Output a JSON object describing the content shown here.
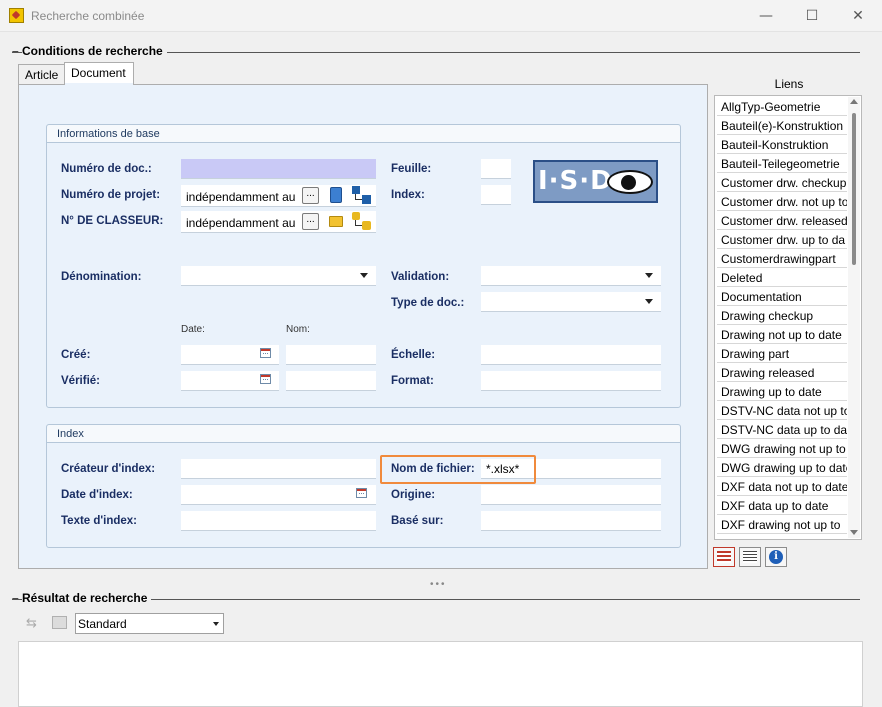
{
  "window": {
    "title": "Recherche combinée",
    "minimize": "—",
    "maximize": "☐",
    "close": "✕"
  },
  "search_conditions": {
    "heading": "Conditions de recherche",
    "collapse_glyph": "–",
    "tabs": [
      {
        "label": "Article",
        "active": false
      },
      {
        "label": "Document",
        "active": true
      }
    ]
  },
  "base_info": {
    "header": "Informations de base",
    "doc_number_label": "Numéro de doc.:",
    "doc_number_value": "",
    "project_number_label": "Numéro de projet:",
    "project_number_value": "indépendamment au",
    "binder_label": "N° DE CLASSEUR:",
    "binder_value": "indépendamment au",
    "dots_button": "...",
    "sheet_label": "Feuille:",
    "index_label": "Index:",
    "logo_text": "I·S·D",
    "designation_label": "Dénomination:",
    "validation_label": "Validation:",
    "doc_type_label": "Type de doc.:",
    "date_col_label": "Date:",
    "name_col_label": "Nom:",
    "created_label": "Créé:",
    "verified_label": "Vérifié:",
    "scale_label": "Échelle:",
    "format_label": "Format:"
  },
  "index_section": {
    "header": "Index",
    "index_creator_label": "Créateur d'index:",
    "index_date_label": "Date d'index:",
    "index_text_label": "Texte d'index:",
    "filename_label": "Nom de fichier:",
    "filename_value": "*.xlsx*",
    "origin_label": "Origine:",
    "based_on_label": "Basé sur:"
  },
  "liens": {
    "title": "Liens",
    "items": [
      "AllgTyp-Geometrie",
      "Bauteil(e)-Konstruktion",
      "Bauteil-Konstruktion",
      "Bauteil-Teilegeometrie",
      "Customer drw. checkup",
      "Customer drw. not up to",
      "Customer drw. released",
      "Customer drw. up to da",
      "Customerdrawingpart",
      "Deleted",
      "Documentation",
      "Drawing checkup",
      "Drawing not up to date",
      "Drawing part",
      "Drawing released",
      "Drawing up to date",
      "DSTV-NC data not up to",
      "DSTV-NC data up to dat",
      "DWG drawing not up to",
      "DWG drawing up to date",
      "DXF data not up to date",
      "DXF data up to date",
      "DXF drawing not up to"
    ]
  },
  "results": {
    "heading": "Résultat de recherche",
    "collapse_glyph": "–",
    "view_value": "Standard"
  },
  "colors": {
    "highlight": "#f08a3c",
    "panel_bg": "#eaf2fb",
    "label_text": "#1a2e63"
  }
}
